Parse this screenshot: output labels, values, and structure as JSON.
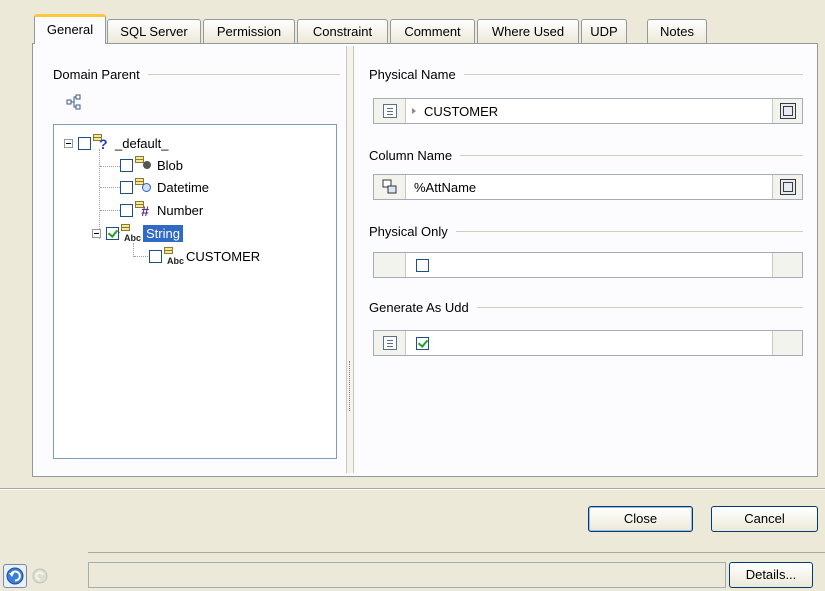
{
  "tabs": [
    {
      "label": "General",
      "active": true
    },
    {
      "label": "SQL Server"
    },
    {
      "label": "Permission"
    },
    {
      "label": "Constraint"
    },
    {
      "label": "Comment"
    },
    {
      "label": "Where Used"
    },
    {
      "label": "UDP"
    },
    {
      "label": "Notes"
    }
  ],
  "domain_parent": {
    "title": "Domain Parent",
    "tree": [
      {
        "label": "_default_",
        "icon": "question-icon",
        "checked": false
      },
      {
        "label": "Blob",
        "icon": "blob-icon",
        "checked": false
      },
      {
        "label": "Datetime",
        "icon": "clock-icon",
        "checked": false
      },
      {
        "label": "Number",
        "icon": "hash-icon",
        "checked": false
      },
      {
        "label": "String",
        "icon": "abc-icon",
        "checked": true,
        "selected": true
      },
      {
        "label": "CUSTOMER",
        "icon": "abc-icon",
        "checked": false
      }
    ]
  },
  "physical_name": {
    "title": "Physical Name",
    "value": "CUSTOMER"
  },
  "column_name": {
    "title": "Column Name",
    "value": "%AttName"
  },
  "physical_only": {
    "title": "Physical Only",
    "checked": false
  },
  "generate_as_udd": {
    "title": "Generate As Udd",
    "checked": true
  },
  "buttons": {
    "close": "Close",
    "cancel": "Cancel",
    "details": "Details..."
  },
  "colors": {
    "tab_highlight": "#ffc83c",
    "selection": "#316ac5",
    "check": "#21a121"
  }
}
